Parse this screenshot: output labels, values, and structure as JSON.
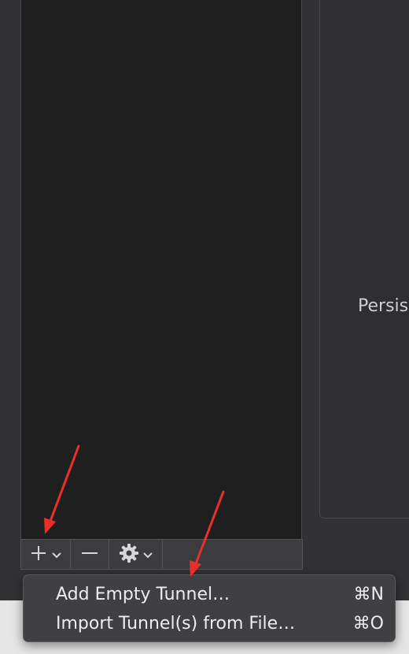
{
  "detail": {
    "visible_text": "Persis"
  },
  "toolbar": {
    "add_icon": "plus-icon",
    "add_menu_icon": "chevron-down-icon",
    "remove_icon": "minus-icon",
    "action_icon": "gear-icon",
    "action_menu_icon": "chevron-down-icon"
  },
  "menu": {
    "items": [
      {
        "label": "Add Empty Tunnel…",
        "shortcut": "⌘N"
      },
      {
        "label": "Import Tunnel(s) from File…",
        "shortcut": "⌘O"
      }
    ]
  },
  "annotation": {
    "arrow_color": "#e8302a"
  }
}
